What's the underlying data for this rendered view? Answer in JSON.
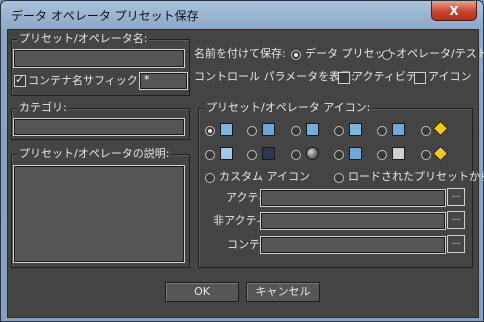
{
  "window": {
    "title": "データ オペレータ プリセット保存",
    "close_glyph": "X"
  },
  "preset_group": {
    "label": "プリセット/オペレータ名:",
    "name_value": "",
    "container_suffix_label": "コンテナ名サフィックス:",
    "container_suffix_checked": true,
    "suffix_value": "*"
  },
  "save_as": {
    "label": "名前を付けて保存:",
    "options": [
      "データ プリセット",
      "オペレータ/テスト"
    ],
    "selected": 0
  },
  "show_params": {
    "label": "コントロール パラメータを表示:",
    "options": [
      {
        "label": "アクティビティ",
        "checked": false
      },
      {
        "label": "アイコン",
        "checked": false
      }
    ]
  },
  "category": {
    "label": "カテゴリ:",
    "value": ""
  },
  "description": {
    "label": "プリセット/オペレータの説明:",
    "value": ""
  },
  "icon_group": {
    "label": "プリセット/オペレータ アイコン:",
    "icons": [
      {
        "name": "grid-dots-icon",
        "selected": true
      },
      {
        "name": "arrow-diagonal-icon"
      },
      {
        "name": "tripod-icon"
      },
      {
        "name": "frame-square-icon"
      },
      {
        "name": "rotate-arrow-icon"
      },
      {
        "name": "yellow-diamond-arrow-icon"
      },
      {
        "name": "square-inset-icon"
      },
      {
        "name": "dark-square-icon"
      },
      {
        "name": "sphere-icon"
      },
      {
        "name": "x-cross-icon"
      },
      {
        "name": "document-icon"
      },
      {
        "name": "yellow-diamond-dots-icon"
      }
    ],
    "custom_icon_label": "カスタム アイコン",
    "loaded_preset_label": "ロードされたプリセットから",
    "active_label": "アクティブ:",
    "inactive_label": "非アクティブ:",
    "container_label": "コンテナ:",
    "browse_label": "..."
  },
  "buttons": {
    "ok": "OK",
    "cancel": "キャンセル"
  }
}
